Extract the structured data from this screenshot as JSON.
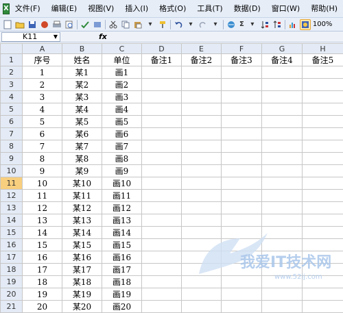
{
  "menu": [
    "文件(F)",
    "编辑(E)",
    "视图(V)",
    "插入(I)",
    "格式(O)",
    "工具(T)",
    "数据(D)",
    "窗口(W)",
    "帮助(H)"
  ],
  "toolbar": {
    "sum": "Σ",
    "zoom": "100%"
  },
  "formula_bar": {
    "name_box": "K11",
    "fx": "fx"
  },
  "columns": [
    "A",
    "B",
    "C",
    "D",
    "E",
    "F",
    "G",
    "H"
  ],
  "selected_row": "11",
  "header_row": {
    "num": "1",
    "cells": [
      "序号",
      "姓名",
      "单位",
      "备注1",
      "备注2",
      "备注3",
      "备注4",
      "备注5"
    ]
  },
  "rows": [
    {
      "num": "2",
      "a": "1",
      "b": "某1",
      "c": "画1"
    },
    {
      "num": "3",
      "a": "2",
      "b": "某2",
      "c": "画2"
    },
    {
      "num": "4",
      "a": "3",
      "b": "某3",
      "c": "画3"
    },
    {
      "num": "5",
      "a": "4",
      "b": "某4",
      "c": "画4"
    },
    {
      "num": "6",
      "a": "5",
      "b": "某5",
      "c": "画5"
    },
    {
      "num": "7",
      "a": "6",
      "b": "某6",
      "c": "画6"
    },
    {
      "num": "8",
      "a": "7",
      "b": "某7",
      "c": "画7"
    },
    {
      "num": "9",
      "a": "8",
      "b": "某8",
      "c": "画8"
    },
    {
      "num": "10",
      "a": "9",
      "b": "某9",
      "c": "画9"
    },
    {
      "num": "11",
      "a": "10",
      "b": "某10",
      "c": "画10"
    },
    {
      "num": "12",
      "a": "11",
      "b": "某11",
      "c": "画11"
    },
    {
      "num": "13",
      "a": "12",
      "b": "某12",
      "c": "画12"
    },
    {
      "num": "14",
      "a": "13",
      "b": "某13",
      "c": "画13"
    },
    {
      "num": "15",
      "a": "14",
      "b": "某14",
      "c": "画14"
    },
    {
      "num": "16",
      "a": "15",
      "b": "某15",
      "c": "画15"
    },
    {
      "num": "17",
      "a": "16",
      "b": "某16",
      "c": "画16"
    },
    {
      "num": "18",
      "a": "17",
      "b": "某17",
      "c": "画17"
    },
    {
      "num": "19",
      "a": "18",
      "b": "某18",
      "c": "画18"
    },
    {
      "num": "20",
      "a": "19",
      "b": "某19",
      "c": "画19"
    },
    {
      "num": "21",
      "a": "20",
      "b": "某20",
      "c": "画20"
    }
  ],
  "watermark": {
    "text": "我爱IT技术网",
    "url": "www.52ij.com"
  },
  "colors": {
    "menu_bg": "#e6edf7",
    "header_bg": "#e4ebf6",
    "selected_row_bg": "#f8cf7e",
    "grid_line": "#c6c6c6"
  }
}
